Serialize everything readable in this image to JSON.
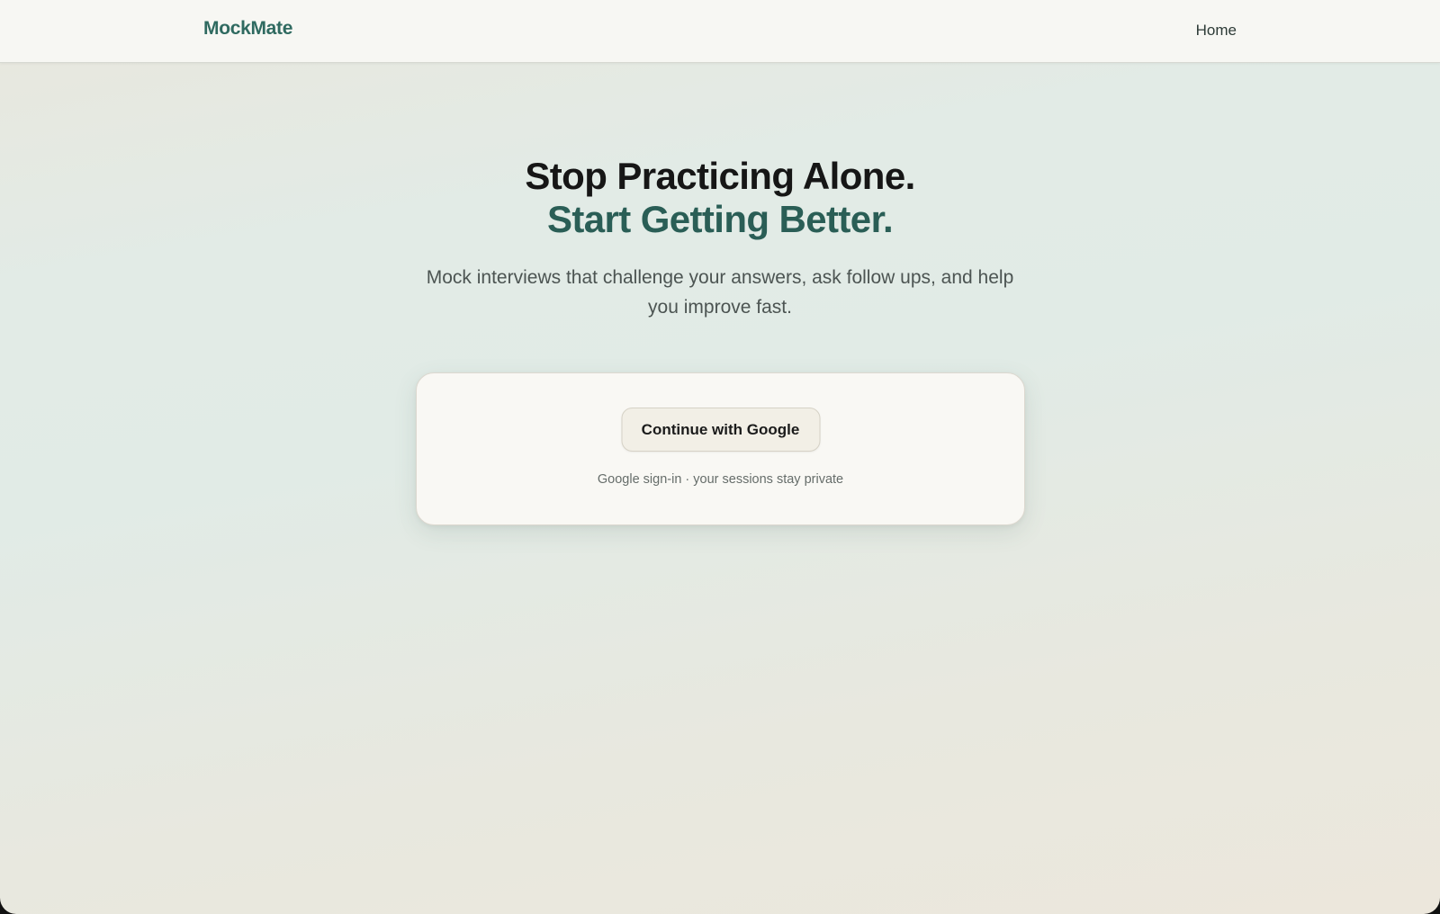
{
  "nav": {
    "brand": "MockMate",
    "home_label": "Home"
  },
  "hero": {
    "headline_line1": "Stop Practicing Alone.",
    "headline_line2": "Start Getting Better.",
    "subtitle": "Mock interviews that challenge your answers, ask follow ups, and help you improve fast."
  },
  "signin": {
    "google_button_label": "Continue with Google",
    "note": "Google sign-in · your sessions stay private"
  },
  "colors": {
    "brand": "#2f6a60",
    "accent_headline": "#2a5e56",
    "card_background": "#f9f8f4",
    "button_background": "#f2efe6"
  }
}
